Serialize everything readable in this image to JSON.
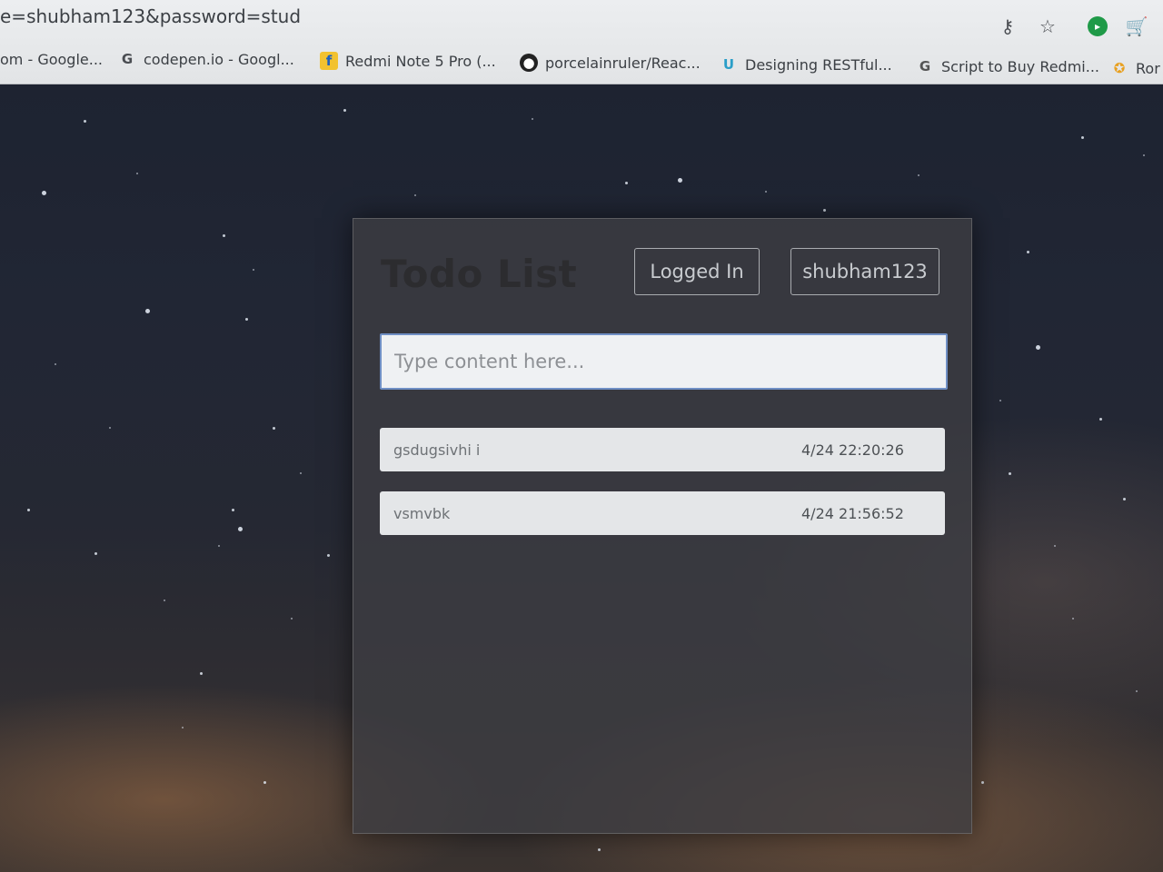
{
  "browser": {
    "url_fragment": "e=shubham123&password=stud",
    "icons": [
      "key-icon",
      "star-icon",
      "extension-icon",
      "cart-icon"
    ],
    "bookmarks": [
      {
        "label": "om - Google...",
        "icon": "none"
      },
      {
        "label": "codepen.io - Googl...",
        "icon": "google-icon"
      },
      {
        "label": "Redmi Note 5 Pro (...",
        "icon": "flipkart-icon"
      },
      {
        "label": "porcelainruler/Reac...",
        "icon": "github-icon"
      },
      {
        "label": "Designing RESTful...",
        "icon": "udacity-icon"
      },
      {
        "label": "Script to Buy Redmi...",
        "icon": "script-icon"
      },
      {
        "label": "Ror",
        "icon": "bookmark-icon"
      }
    ]
  },
  "app": {
    "title": "Todo List",
    "status_button": "Logged In",
    "user_button": "shubham123",
    "input_placeholder": "Type content here...",
    "todos": [
      {
        "text": "gsdugsivhi i",
        "time": "4/24 22:20:26"
      },
      {
        "text": "vsmvbk",
        "time": "4/24 21:56:52"
      }
    ]
  },
  "colors": {
    "panel": "#3e3e42",
    "input_border": "#6f8fc4",
    "item_bg": "#e4e6e8"
  }
}
